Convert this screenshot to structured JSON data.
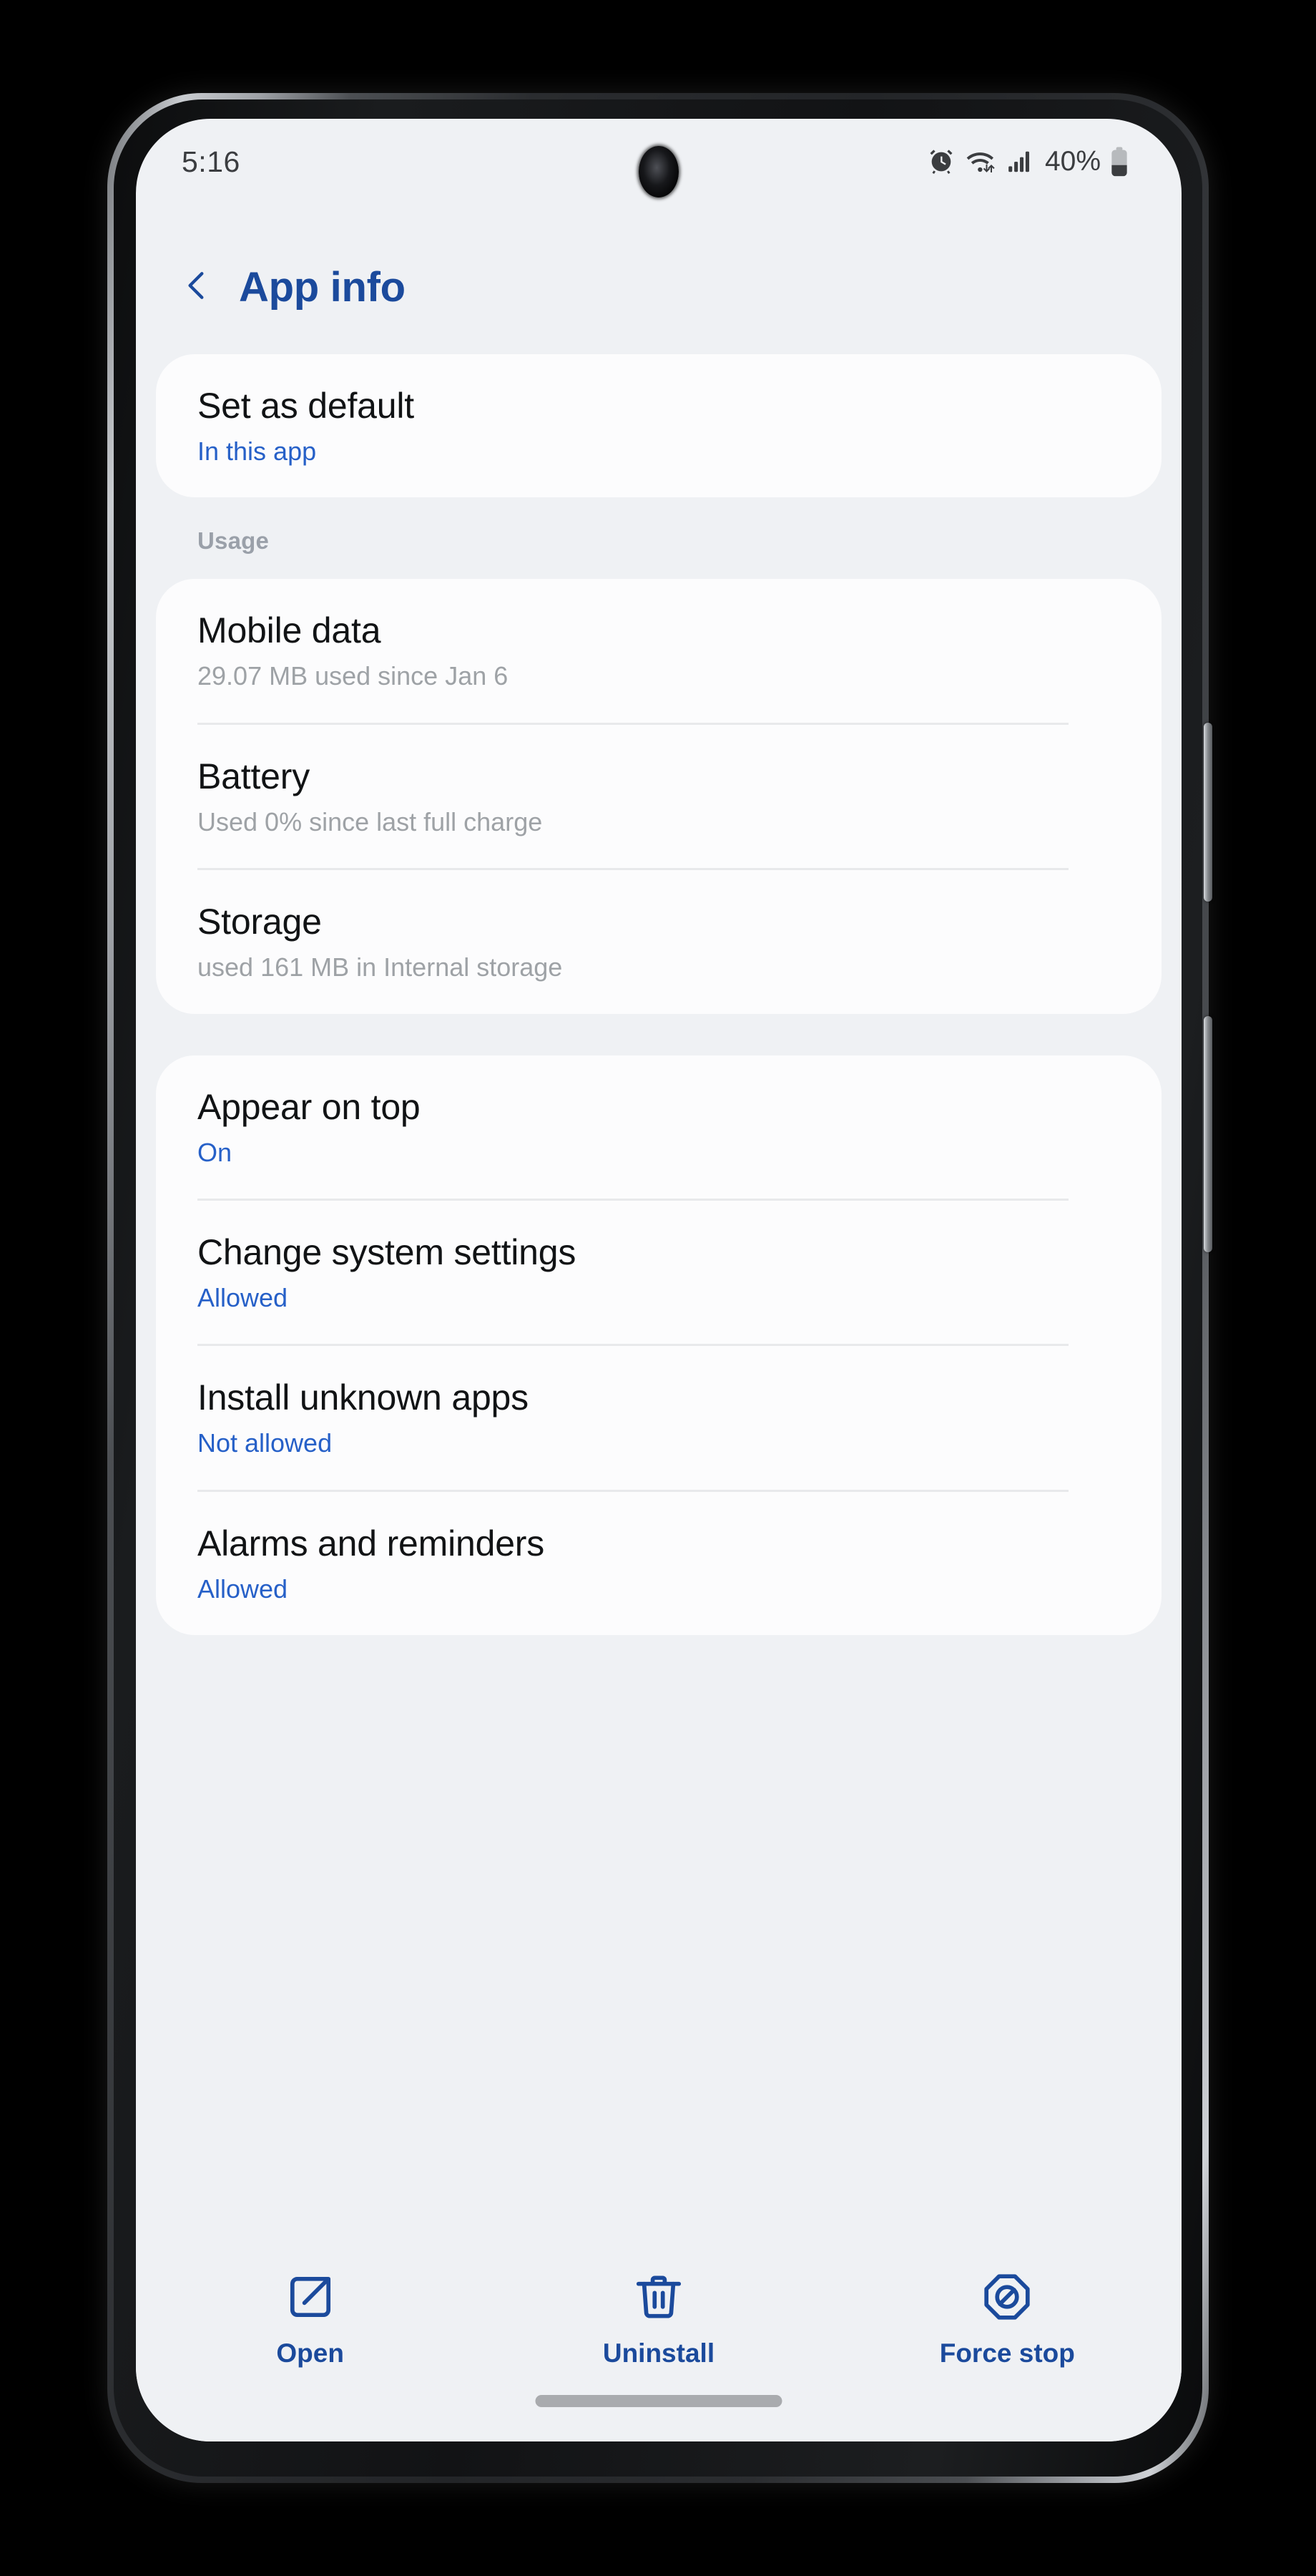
{
  "statusbar": {
    "time": "5:16",
    "battery_percent": "40%",
    "icons": [
      "alarm-icon",
      "wifi-icon",
      "cellular-signal-icon",
      "battery-icon"
    ]
  },
  "appbar": {
    "back_icon": "chevron-left-icon",
    "title": "App info"
  },
  "colors": {
    "accent_blue": "#1B4A9C",
    "link_blue": "#2660C8",
    "screen_bg": "#EFF1F4",
    "card_bg": "#FCFCFD",
    "subtitle_grey": "#9EA2A6"
  },
  "cards": [
    {
      "name": "default-card",
      "section_label": null,
      "rows": [
        {
          "title": "Set as default",
          "sub": "In this app",
          "sub_style": "blue"
        }
      ]
    },
    {
      "name": "usage-card",
      "section_label": "Usage",
      "rows": [
        {
          "title": "Mobile data",
          "sub": "29.07 MB used since Jan 6",
          "sub_style": "grey"
        },
        {
          "title": "Battery",
          "sub": "Used 0% since last full charge",
          "sub_style": "grey"
        },
        {
          "title": "Storage",
          "sub": "used 161 MB in Internal storage",
          "sub_style": "grey"
        }
      ]
    },
    {
      "name": "permissions-card",
      "section_label": null,
      "rows": [
        {
          "title": "Appear on top",
          "sub": "On",
          "sub_style": "blue"
        },
        {
          "title": "Change system settings",
          "sub": "Allowed",
          "sub_style": "blue"
        },
        {
          "title": "Install unknown apps",
          "sub": "Not allowed",
          "sub_style": "blue"
        },
        {
          "title": "Alarms and reminders",
          "sub": "Allowed",
          "sub_style": "blue"
        }
      ]
    }
  ],
  "actionbar": {
    "actions": [
      {
        "label": "Open",
        "icon": "external-link-icon"
      },
      {
        "label": "Uninstall",
        "icon": "trash-icon"
      },
      {
        "label": "Force stop",
        "icon": "octagon-block-icon"
      }
    ]
  }
}
